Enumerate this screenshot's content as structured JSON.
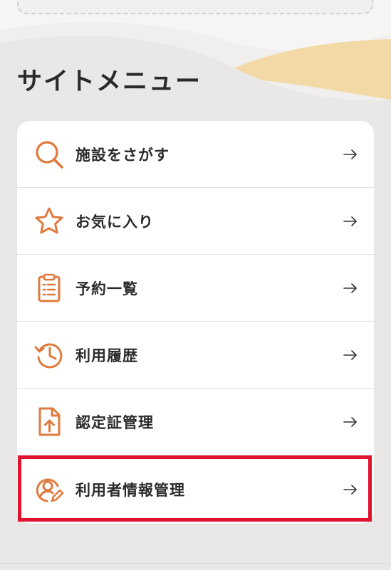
{
  "section": {
    "title": "サイトメニュー"
  },
  "menu": {
    "items": [
      {
        "label": "施設をさがす",
        "icon": "search-icon"
      },
      {
        "label": "お気に入り",
        "icon": "star-icon"
      },
      {
        "label": "予約一覧",
        "icon": "clipboard-list-icon"
      },
      {
        "label": "利用履歴",
        "icon": "history-clock-icon"
      },
      {
        "label": "認定証管理",
        "icon": "document-upload-icon"
      },
      {
        "label": "利用者情報管理",
        "icon": "user-edit-icon"
      }
    ],
    "arrow_icon": "arrow-right-icon",
    "highlighted_item": "利用者情報管理"
  },
  "colors": {
    "accent": "#e07a3c",
    "background": "#f0efed",
    "wave_bg": "#e9e8e6",
    "wave_accent": "#f3d9a6",
    "card": "#ffffff",
    "highlight": "#e0132f"
  }
}
